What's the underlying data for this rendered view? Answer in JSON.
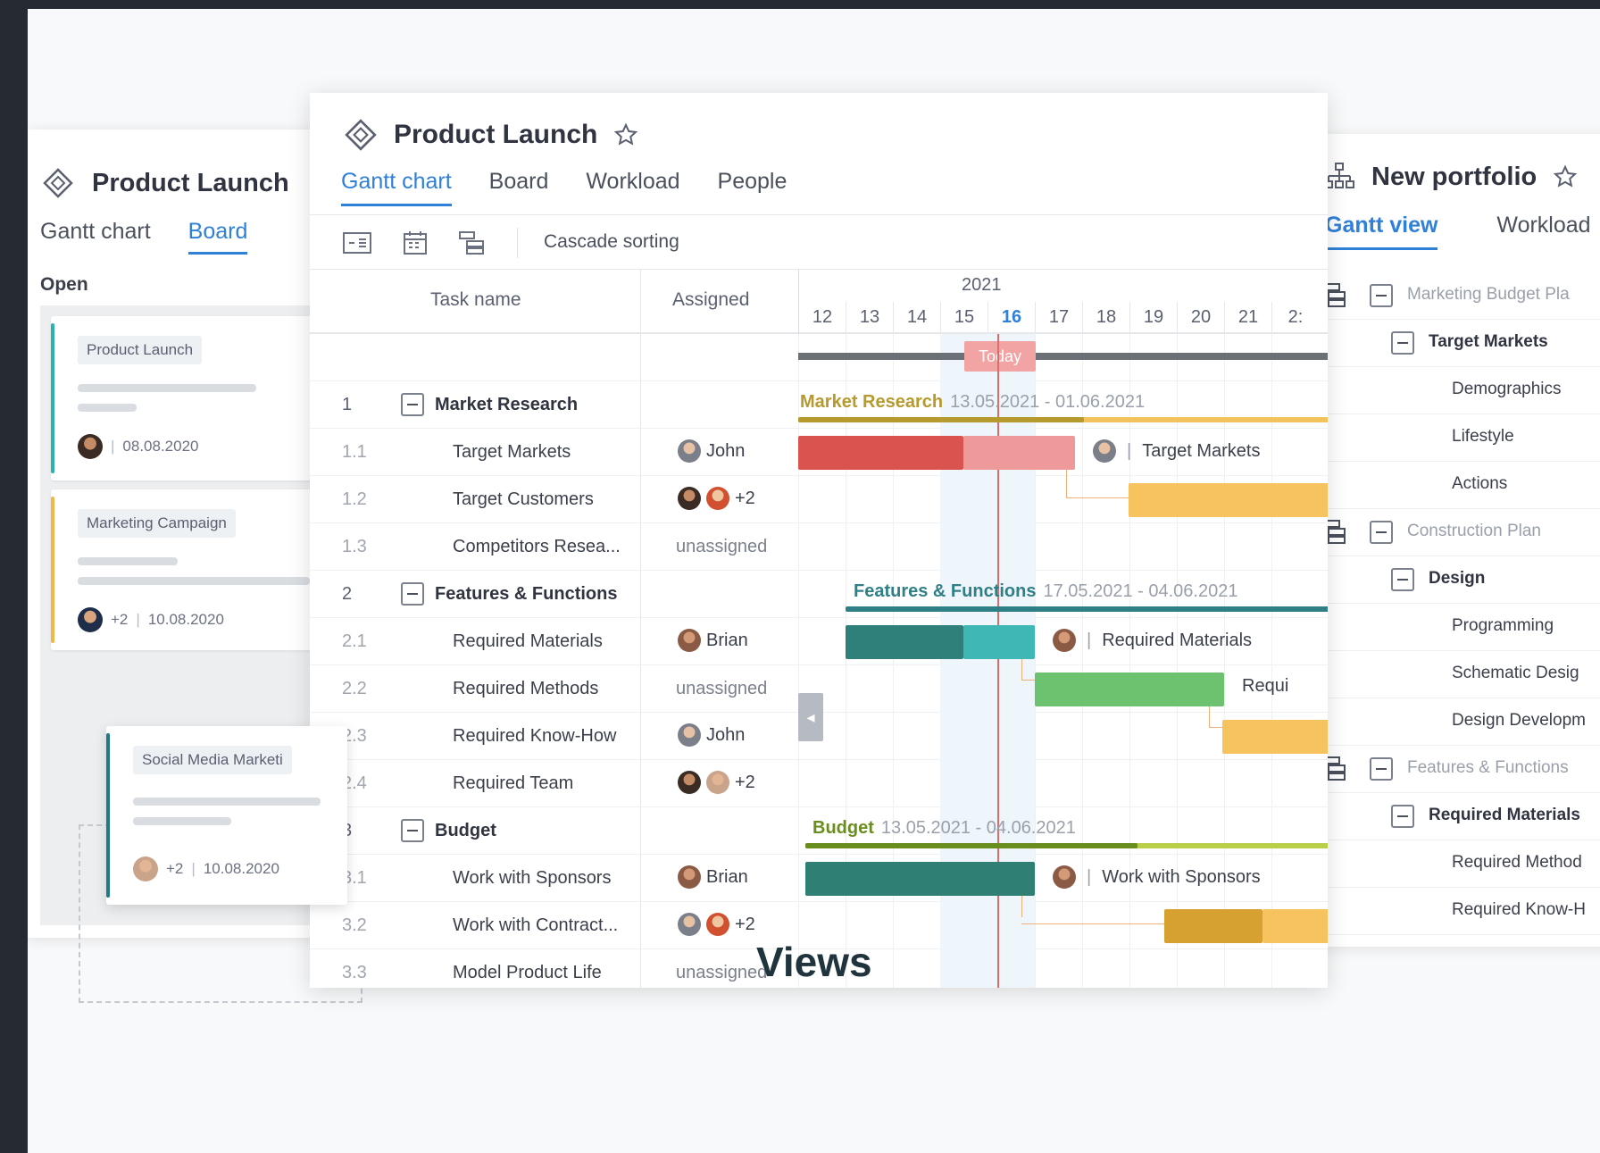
{
  "left_panel": {
    "title": "Product Launch",
    "tabs": [
      "Gantt chart",
      "Board"
    ],
    "active_tab": "Board",
    "column_label": "Open",
    "cards": [
      {
        "chip": "Product Launch",
        "date": "08.08.2020",
        "extra": "",
        "color": "#2bb0b4"
      },
      {
        "chip": "Marketing Campaign",
        "date": "10.08.2020",
        "extra": "+2",
        "color": "#f2b548"
      },
      {
        "chip": "Social Media Marketi",
        "date": "10.08.2020",
        "extra": "+2",
        "color": "#1f7a86"
      }
    ]
  },
  "main_panel": {
    "title": "Product Launch",
    "tabs": [
      "Gantt chart",
      "Board",
      "Workload",
      "People"
    ],
    "active_tab": "Gantt chart",
    "toolbar": {
      "cascade_label": "Cascade sorting"
    },
    "columns": {
      "task_name": "Task name",
      "assigned": "Assigned"
    },
    "year": "2021",
    "days": [
      "12",
      "13",
      "14",
      "15",
      "16",
      "17",
      "18",
      "19",
      "20",
      "21",
      "2:"
    ],
    "today_day": "16",
    "today_label": "Today",
    "rows": [
      {
        "num": "1",
        "name": "Market Research",
        "group": true,
        "assigned": ""
      },
      {
        "num": "1.1",
        "name": "Target Markets",
        "assigned": "John",
        "avatars": [
          "grey"
        ]
      },
      {
        "num": "1.2",
        "name": "Target Customers",
        "assigned": "+2",
        "avatars": [
          "dark",
          "red"
        ]
      },
      {
        "num": "1.3",
        "name": "Competitors Resea...",
        "assigned": "unassigned"
      },
      {
        "num": "2",
        "name": "Features & Functions",
        "group": true,
        "assigned": ""
      },
      {
        "num": "2.1",
        "name": "Required Materials",
        "assigned": "Brian",
        "avatars": [
          "brown"
        ]
      },
      {
        "num": "2.2",
        "name": "Required Methods",
        "assigned": "unassigned"
      },
      {
        "num": "2.3",
        "name": "Required Know-How",
        "assigned": "John",
        "avatars": [
          "grey"
        ]
      },
      {
        "num": "2.4",
        "name": "Required Team",
        "assigned": "+2",
        "avatars": [
          "dark",
          "light"
        ]
      },
      {
        "num": "3",
        "name": "Budget",
        "group": true,
        "assigned": ""
      },
      {
        "num": "3.1",
        "name": "Work with Sponsors",
        "assigned": "Brian",
        "avatars": [
          "brown"
        ]
      },
      {
        "num": "3.2",
        "name": "Work with Contract...",
        "assigned": "+2",
        "avatars": [
          "grey",
          "red"
        ]
      },
      {
        "num": "3.3",
        "name": "Model Product Life",
        "assigned": "unassigned"
      }
    ],
    "gantt_groups": [
      {
        "name": "Market Research",
        "dates": "13.05.2021 - 01.06.2021",
        "color": "#b79a2e"
      },
      {
        "name": "Features & Functions",
        "dates": "17.05.2021 - 04.06.2021",
        "color": "#2f7f86"
      },
      {
        "name": "Budget",
        "dates": "13.05.2021 - 04.06.2021",
        "color": "#6a8d1f"
      }
    ],
    "bar_labels": [
      "Target Markets",
      "Required Materials",
      "Requi",
      "Work with Sponsors"
    ]
  },
  "right_panel": {
    "title": "New portfolio",
    "tabs": [
      "Gantt view",
      "Workload"
    ],
    "active_tab": "Gantt view",
    "tree": [
      {
        "type": "project",
        "label": "Marketing Budget Pla"
      },
      {
        "type": "group",
        "label": "Target Markets"
      },
      {
        "type": "leaf",
        "label": "Demographics"
      },
      {
        "type": "leaf",
        "label": "Lifestyle"
      },
      {
        "type": "leaf",
        "label": "Actions"
      },
      {
        "type": "project",
        "label": "Construction Plan"
      },
      {
        "type": "group",
        "label": "Design"
      },
      {
        "type": "leaf",
        "label": "Programming"
      },
      {
        "type": "leaf",
        "label": "Schematic Desig"
      },
      {
        "type": "leaf",
        "label": "Design Developm"
      },
      {
        "type": "project",
        "label": "Features & Functions"
      },
      {
        "type": "group",
        "label": "Required Materials"
      },
      {
        "type": "leaf",
        "label": "Required Method"
      },
      {
        "type": "leaf",
        "label": "Required Know-H"
      }
    ]
  },
  "caption": "Views"
}
